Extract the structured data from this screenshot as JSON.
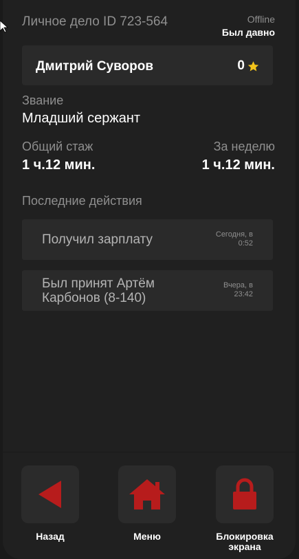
{
  "header": {
    "dossier_title": "Личное дело ID 723-564",
    "status": "Offline",
    "last_seen": "Был давно"
  },
  "profile": {
    "name": "Дмитрий Суворов",
    "score": "0",
    "rank_label": "Звание",
    "rank_value": "Младший сержант",
    "total_label": "Общий стаж",
    "total_value": "1 ч.12 мин.",
    "week_label": "За неделю",
    "week_value": "1 ч.12 мин."
  },
  "activity": {
    "title": "Последние действия",
    "items": [
      {
        "text": "Получил зарплату",
        "time_day": "Сегодня, в",
        "time_clock": "0:52"
      },
      {
        "text_line1": "Был принят Артём",
        "text_line2": "Карбонов (8-140)",
        "time_day": "Вчера, в",
        "time_clock": "23:42"
      }
    ]
  },
  "nav": {
    "back_label": "Назад",
    "menu_label": "Меню",
    "lock_label_line1": "Блокировка",
    "lock_label_line2": "экрана"
  },
  "colors": {
    "accent_red": "#b71c1c",
    "star_yellow": "#f2c31b",
    "background": "#202020",
    "card": "#2a2a2a"
  },
  "icons": [
    "mouse-cursor-icon",
    "star-icon",
    "back-arrow-icon",
    "home-icon",
    "lock-icon"
  ]
}
